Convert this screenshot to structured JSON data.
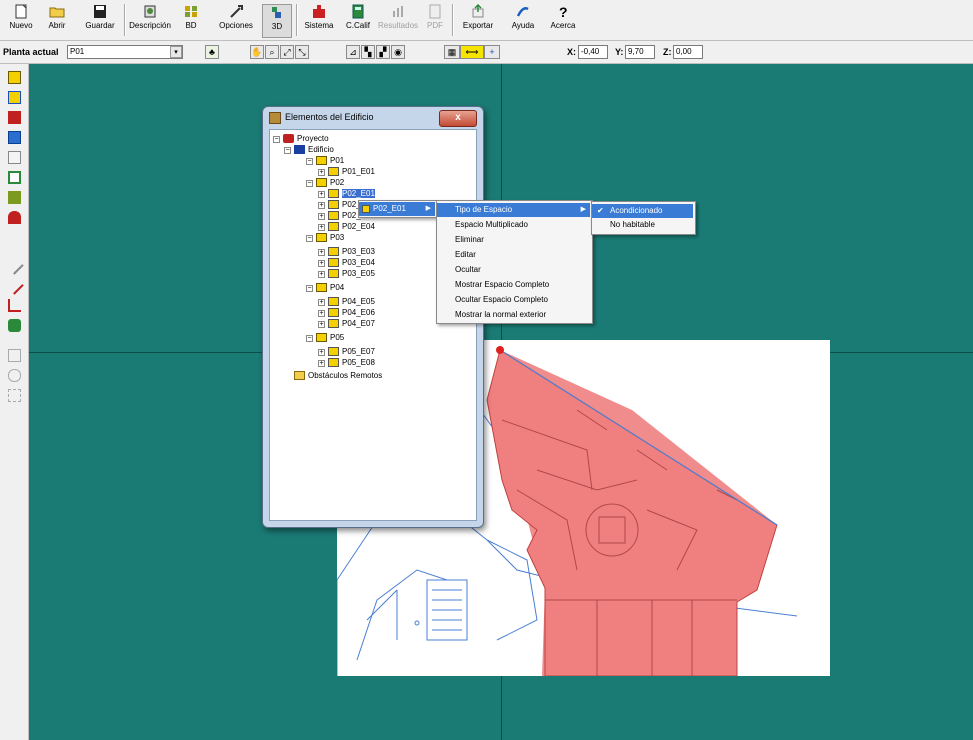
{
  "toolbar": {
    "buttons": [
      {
        "label": "Nuevo",
        "icon": "new-file-icon"
      },
      {
        "label": "Abrir",
        "icon": "open-folder-icon"
      },
      {
        "label": "Guardar",
        "icon": "save-disk-icon"
      },
      {
        "label": "Descripción",
        "icon": "description-icon"
      },
      {
        "label": "BD",
        "icon": "database-icon"
      },
      {
        "label": "Opciones",
        "icon": "options-icon"
      },
      {
        "label": "3D",
        "icon": "3d-view-icon"
      },
      {
        "label": "Sistema",
        "icon": "system-icon"
      },
      {
        "label": "C.Calif",
        "icon": "calculator-icon"
      },
      {
        "label": "Resultados",
        "icon": "results-icon"
      },
      {
        "label": "PDF",
        "icon": "pdf-icon"
      },
      {
        "label": "Exportar",
        "icon": "export-icon"
      },
      {
        "label": "Ayuda",
        "icon": "help-icon"
      },
      {
        "label": "Acerca",
        "icon": "about-icon"
      }
    ]
  },
  "row2": {
    "planta_label": "Planta actual",
    "planta_value": "P01",
    "x_label": "X:",
    "x_value": "-0,40",
    "y_label": "Y:",
    "y_value": "9,70",
    "z_label": "Z:",
    "z_value": "0,00"
  },
  "window": {
    "title": "Elementos del Edificio",
    "close_glyph": "x",
    "tree": [
      {
        "label": "Proyecto"
      },
      {
        "label": "Edificio"
      },
      {
        "label": "P01"
      },
      {
        "label": "P01_E01"
      },
      {
        "label": "P02"
      },
      {
        "label": "P02_E01"
      },
      {
        "label": "P02_E02"
      },
      {
        "label": "P02_E03"
      },
      {
        "label": "P02_E04"
      },
      {
        "label": "P03"
      },
      {
        "label": "P03_E03"
      },
      {
        "label": "P03_E04"
      },
      {
        "label": "P03_E05"
      },
      {
        "label": "P04"
      },
      {
        "label": "P04_E05"
      },
      {
        "label": "P04_E06"
      },
      {
        "label": "P04_E07"
      },
      {
        "label": "P05"
      },
      {
        "label": "P05_E07"
      },
      {
        "label": "P05_E08"
      },
      {
        "label": "Obstáculos Remotos"
      }
    ]
  },
  "context_menu_1": {
    "label": "P02_E01"
  },
  "context_menu_2": {
    "items": [
      {
        "label": "Tipo de Espacio"
      },
      {
        "label": "Espacio Multiplicado"
      },
      {
        "label": "Eliminar"
      },
      {
        "label": "Editar"
      },
      {
        "label": "Ocultar"
      },
      {
        "label": "Mostrar Espacio Completo"
      },
      {
        "label": "Ocultar Espacio Completo"
      },
      {
        "label": "Mostrar la normal exterior"
      }
    ]
  },
  "context_menu_3": {
    "items": [
      {
        "label": "Acondicionado",
        "checked": true
      },
      {
        "label": "No habitable",
        "checked": false
      }
    ]
  },
  "colors": {
    "canvas": "#1a7a74",
    "space_fill": "#f08080",
    "plan_lines": "#4a7fd4",
    "highlight": "#3a7bd5"
  }
}
